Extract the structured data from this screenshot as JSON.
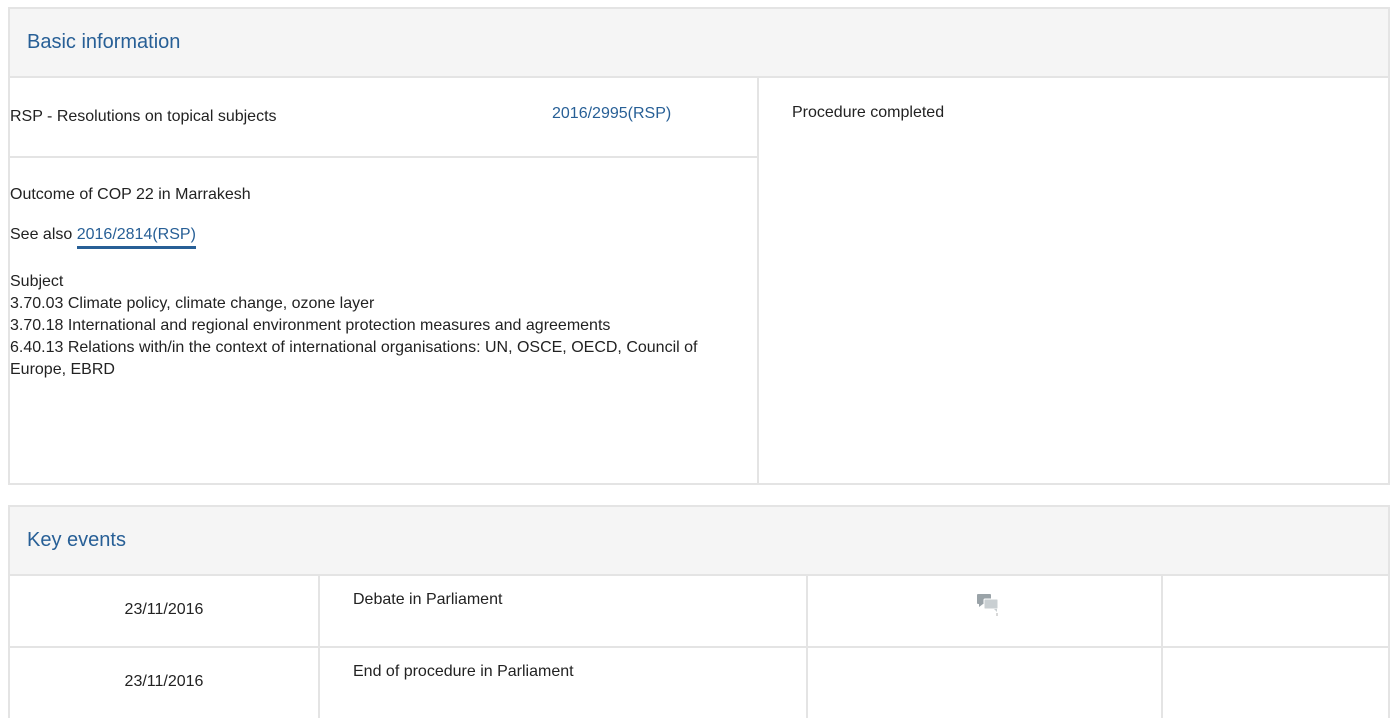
{
  "basic": {
    "title": "Basic information",
    "procedure_type": "RSP - Resolutions on topical subjects",
    "reference": "2016/2995(RSP)",
    "status": "Procedure completed",
    "dossier_title": "Outcome of COP 22 in Marrakesh",
    "see_also_label": "See also",
    "see_also_ref": "2016/2814(RSP)",
    "subject_label": "Subject",
    "subjects": [
      "3.70.03 Climate policy, climate change, ozone layer",
      "3.70.18 International and regional environment protection measures and agreements",
      "6.40.13 Relations with/in the context of international organisations: UN, OSCE, OECD, Council of Europe, EBRD"
    ]
  },
  "events": {
    "title": "Key events",
    "rows": [
      {
        "date": "23/11/2016",
        "event": "Debate in Parliament",
        "icon": "debate-icon"
      },
      {
        "date": "23/11/2016",
        "event": "End of procedure in Parliament"
      }
    ]
  },
  "colors": {
    "accent": "#275f96",
    "border": "#e4e4e4",
    "header_bg": "#f5f5f5"
  }
}
